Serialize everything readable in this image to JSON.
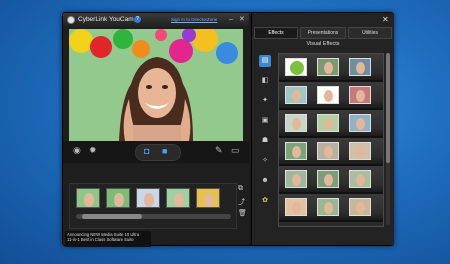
{
  "window": {
    "title": "CyberLink YouCam",
    "help_label": "?",
    "signin_link": "Sign In to DirectorZone",
    "minimize": "–",
    "close": "✕"
  },
  "toolbar": {
    "eye_icon": "eye-icon",
    "settings_icon": "gear-icon",
    "camera_icon": "camera-icon",
    "video_icon": "video-icon",
    "brush_icon": "brush-icon",
    "fullscreen_icon": "fullscreen-icon"
  },
  "filmstrip": {
    "count": 5
  },
  "ad": {
    "line1": "Announcing NEW Media Suite 10 Ultra",
    "line2": "11-in-1 Best in Class Software Suite"
  },
  "panel": {
    "tabs": [
      "Effects",
      "Presentations",
      "Utilities"
    ],
    "active_tab": "Effects",
    "section_title": "Visual Effects",
    "close": "✕",
    "category_icons": [
      "scene-icon",
      "filter-icon",
      "particle-icon",
      "frame-icon",
      "distortion-icon",
      "emotion-icon",
      "gadget-icon",
      "avatar-icon"
    ]
  },
  "colors": {
    "accent": "#2f7bd6",
    "window_bg": "#1b1b1b"
  }
}
